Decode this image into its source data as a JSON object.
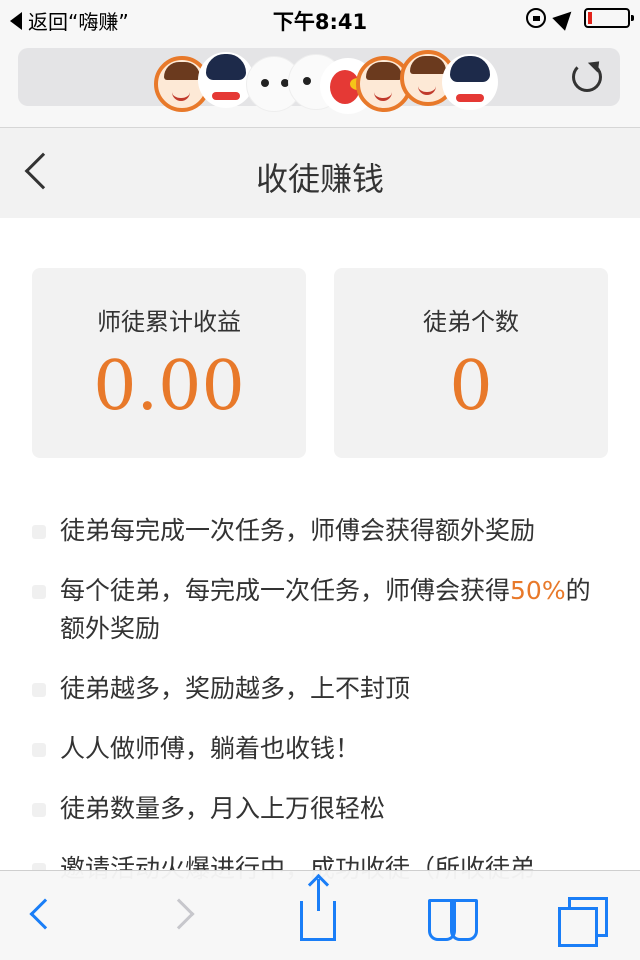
{
  "status_bar": {
    "back_app": "返回“嗨赚”",
    "time": "下午8:41"
  },
  "nav": {
    "title": "收徒赚钱"
  },
  "stats": [
    {
      "label": "师徒累计收益",
      "value": "0.00"
    },
    {
      "label": "徒弟个数",
      "value": "0"
    }
  ],
  "rules": [
    {
      "text": "徒弟每完成一次任务，师傅会获得额外奖励"
    },
    {
      "text_before": "每个徒弟，每完成一次任务，师傅会获得",
      "highlight": "50%",
      "text_after": "的额外奖励"
    },
    {
      "text": "徒弟越多，奖励越多，上不封顶"
    },
    {
      "text": "人人做师傅，躺着也收钱！"
    },
    {
      "text": "徒弟数量多，月入上万很轻松"
    },
    {
      "text": "邀请活动火爆进行中，成功收徒（所收徒弟"
    }
  ],
  "colors": {
    "accent": "#e8792a",
    "ios_blue": "#1a7ef7"
  }
}
